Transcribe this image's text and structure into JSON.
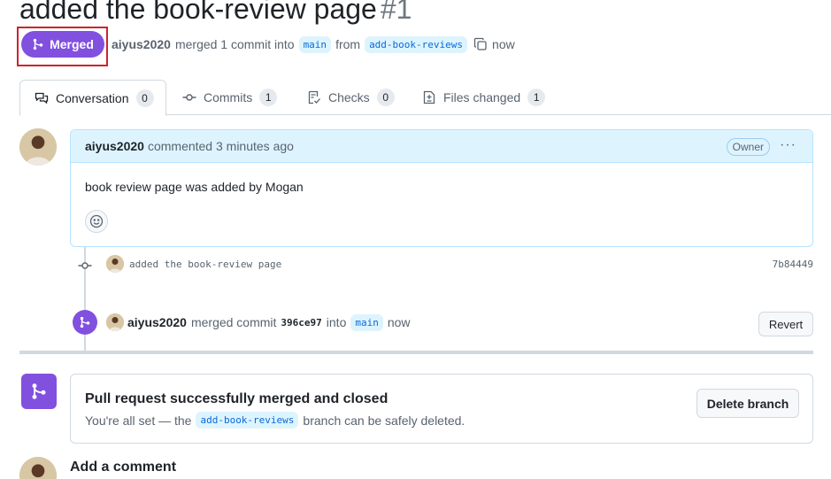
{
  "pr": {
    "title": "added the book-review page",
    "number": "#1",
    "status": "Merged",
    "author": "aiyus2020",
    "meta_text": "merged 1 commit into",
    "base_branch": "main",
    "from_text": "from",
    "head_branch": "add-book-reviews",
    "time": "now"
  },
  "tabs": [
    {
      "label": "Conversation",
      "count": "0",
      "icon": "comment-discussion-icon"
    },
    {
      "label": "Commits",
      "count": "1",
      "icon": "git-commit-icon"
    },
    {
      "label": "Checks",
      "count": "0",
      "icon": "checklist-icon"
    },
    {
      "label": "Files changed",
      "count": "1",
      "icon": "file-diff-icon"
    }
  ],
  "comment": {
    "author": "aiyus2020",
    "action": "commented 3 minutes ago",
    "role": "Owner",
    "menu": "···",
    "body": "book review page was added by Mogan"
  },
  "commit": {
    "message": "added the book-review page",
    "sha": "7b84449"
  },
  "merge_event": {
    "user": "aiyus2020",
    "text": "merged commit",
    "sha": "396ce97",
    "into": "into",
    "branch": "main",
    "time": "now",
    "revert_label": "Revert"
  },
  "merge_status": {
    "title": "Pull request successfully merged and closed",
    "desc_prefix": "You're all set — the",
    "branch": "add-book-reviews",
    "desc_suffix": "branch can be safely deleted.",
    "delete_label": "Delete branch"
  },
  "add_comment": {
    "title": "Add a comment"
  },
  "colors": {
    "merged_purple": "#8250df",
    "highlight_red": "#cf222e",
    "link_blue": "#0969da",
    "comment_header_bg": "#ddf4ff"
  }
}
